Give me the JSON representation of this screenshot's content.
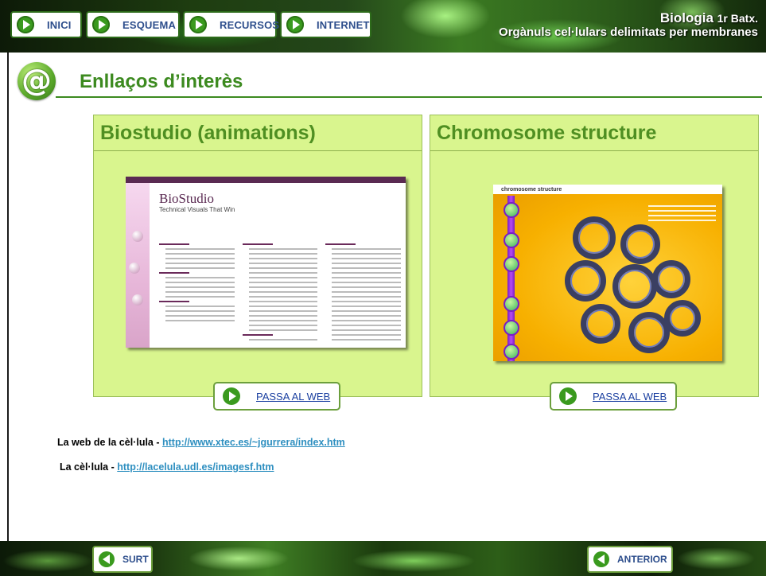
{
  "nav": {
    "buttons": [
      {
        "label": "INICI",
        "icon": "play-icon"
      },
      {
        "label": "ESQUEMA",
        "icon": "play-icon"
      },
      {
        "label": "RECURSOS",
        "icon": "play-icon"
      },
      {
        "label": "INTERNET",
        "icon": "play-icon"
      }
    ]
  },
  "header": {
    "course": "Biologia",
    "level": "1r Batx.",
    "subtitle": "Orgànuls cel·lulars delimitats per membranes"
  },
  "section": {
    "icon": "at-sign-icon",
    "icon_glyph": "@",
    "title": "Enllaços d’interès"
  },
  "cards": [
    {
      "title": "Biostudio (animations)",
      "button_label": "PASSA AL WEB",
      "preview": {
        "logo": "BioStudio",
        "tagline": "Technical Visuals That Win"
      }
    },
    {
      "title": "Chromosome structure",
      "button_label": "PASSA AL WEB",
      "preview": {
        "heading": "chromosome structure"
      }
    }
  ],
  "links": [
    {
      "prefix": "La web de la cèl·lula - ",
      "url": "http://www.xtec.es/~jgurrera/index.htm"
    },
    {
      "prefix": "La cèl·lula - ",
      "url": "http://lacelula.udl.es/imagesf.htm"
    }
  ],
  "footer": {
    "exit_label": "SURT",
    "prev_label": "ANTERIOR"
  },
  "colors": {
    "accent_green": "#3c8a1f",
    "card_bg": "#d9f58e",
    "link_blue": "#2e8fc0",
    "nav_text": "#2d4e8c"
  }
}
